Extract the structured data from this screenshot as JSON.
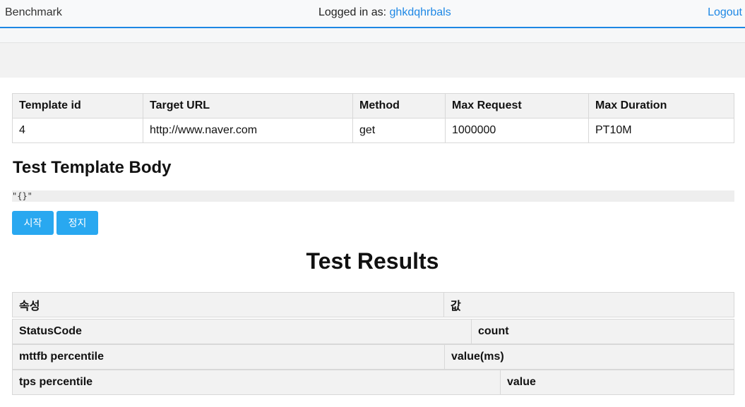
{
  "navbar": {
    "brand": "Benchmark",
    "logged_in_label": "Logged in as: ",
    "username": "ghkdqhrbals",
    "logout": "Logout"
  },
  "template_table": {
    "headers": [
      "Template id",
      "Target URL",
      "Method",
      "Max Request",
      "Max Duration"
    ],
    "row": [
      "4",
      "http://www.naver.com",
      "get",
      "1000000",
      "PT10M"
    ]
  },
  "template_body": {
    "title": "Test Template Body",
    "content": "\"{}\""
  },
  "buttons": {
    "start": "시작",
    "stop": "정지"
  },
  "results": {
    "title": "Test Results",
    "rows": [
      [
        "속성",
        "값"
      ],
      [
        "StatusCode",
        "count"
      ],
      [
        "mttfb percentile",
        "value(ms)"
      ],
      [
        "tps percentile",
        "value"
      ]
    ]
  },
  "colors": {
    "accent": "#1e88e5",
    "button": "#29a8f0"
  }
}
